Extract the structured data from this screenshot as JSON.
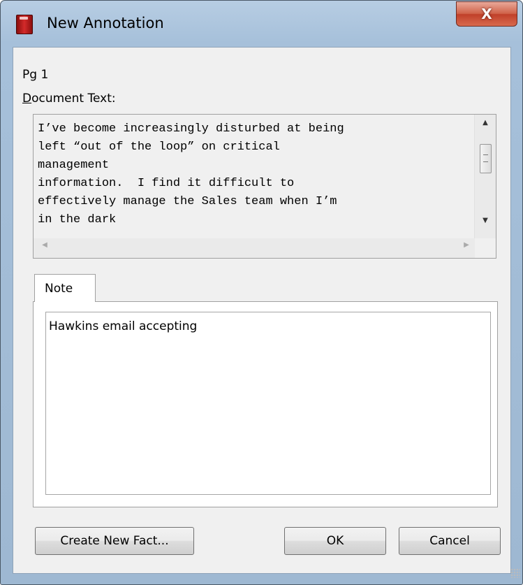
{
  "window": {
    "title": "New Annotation",
    "close_glyph": "X",
    "icon": "app-book-icon"
  },
  "page_label": "Pg 1",
  "document": {
    "label_mnemonic": "D",
    "label_rest": "ocument Text:",
    "text": "I’ve become increasingly disturbed at being\nleft “out of the loop” on critical\nmanagement\ninformation.  I find it difficult to\neffectively manage the Sales team when I’m\nin the dark"
  },
  "tabs": [
    {
      "label": "Note"
    }
  ],
  "note": {
    "value": "Hawkins email accepting"
  },
  "buttons": {
    "create_new_fact": "Create New Fact...",
    "ok": "OK",
    "cancel": "Cancel"
  },
  "scrollbar": {
    "up_icon": "▲",
    "down_icon": "▼",
    "left_icon": "◀",
    "right_icon": "▶"
  }
}
